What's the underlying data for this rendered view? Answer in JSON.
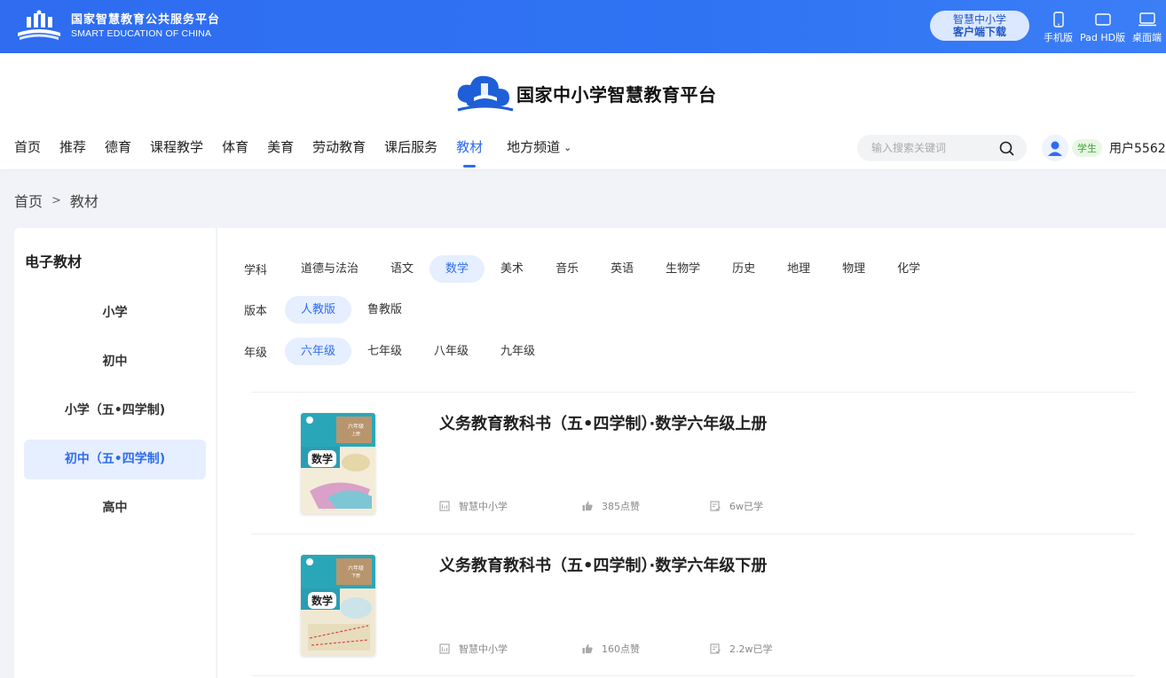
{
  "topbar": {
    "brand_cn": "国家智慧教育公共服务平台",
    "brand_en": "SMART EDUCATION OF CHINA",
    "download_line1": "智慧中小学",
    "download_line2": "客户端下载",
    "devices": [
      {
        "label": "手机版",
        "icon": "phone-icon"
      },
      {
        "label": "Pad HD版",
        "icon": "tablet-icon"
      },
      {
        "label": "桌面端",
        "icon": "desktop-icon"
      }
    ],
    "color": "#2f6cf0"
  },
  "header": {
    "site_title": "国家中小学智慧教育平台",
    "nav": [
      "首页",
      "推荐",
      "德育",
      "课程教学",
      "体育",
      "美育",
      "劳动教育",
      "课后服务",
      "教材",
      "地方频道"
    ],
    "nav_active": "教材",
    "search_placeholder": "输入搜索关键词",
    "role": "学生",
    "username": "用户5562"
  },
  "breadcrumb": {
    "home": "首页",
    "sep": ">",
    "current": "教材"
  },
  "sidebar": {
    "title": "电子教材",
    "items": [
      "小学",
      "初中",
      "小学（五•四学制)",
      "初中（五•四学制)",
      "高中"
    ],
    "active_index": 3
  },
  "filters": {
    "subject": {
      "label": "学科",
      "options": [
        "道德与法治",
        "语文",
        "数学",
        "美术",
        "音乐",
        "英语",
        "生物学",
        "历史",
        "地理",
        "物理",
        "化学"
      ],
      "active": "数学"
    },
    "edition": {
      "label": "版本",
      "options": [
        "人教版",
        "鲁教版"
      ],
      "active": "人教版"
    },
    "grade": {
      "label": "年级",
      "options": [
        "六年级",
        "七年级",
        "八年级",
        "九年级"
      ],
      "active": "六年级"
    }
  },
  "books": [
    {
      "title": "义务教育教科书（五•四学制）·数学六年级上册",
      "cover_subject": "数学",
      "cover_grade": "六年级",
      "cover_volume": "上册",
      "publisher": "智慧中小学",
      "likes": "385点赞",
      "learners": "6w已学"
    },
    {
      "title": "义务教育教科书（五•四学制）·数学六年级下册",
      "cover_subject": "数学",
      "cover_grade": "六年级",
      "cover_volume": "下册",
      "publisher": "智慧中小学",
      "likes": "160点赞",
      "learners": "2.2w已学"
    }
  ]
}
